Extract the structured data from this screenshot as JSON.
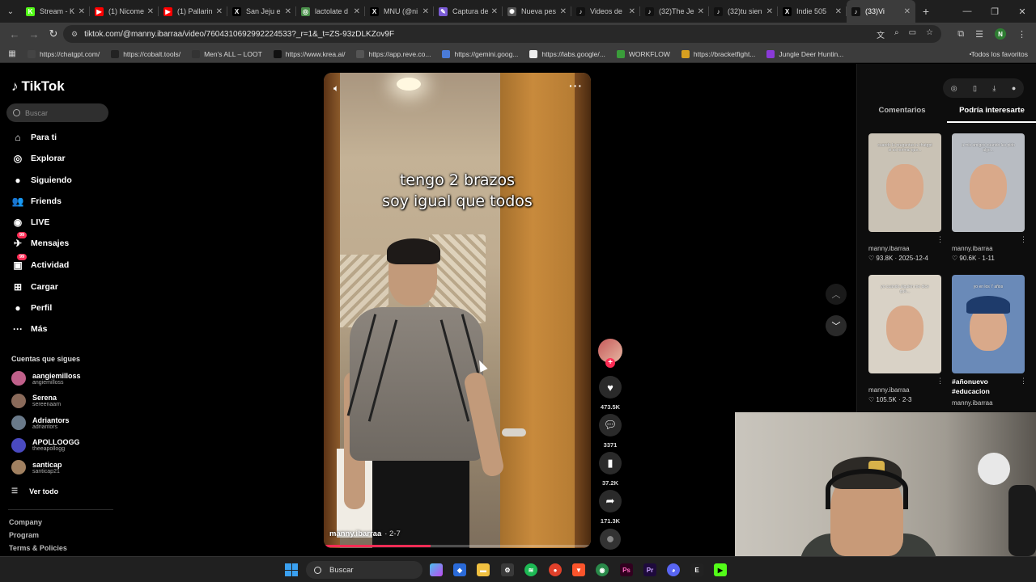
{
  "browser": {
    "tabs": [
      {
        "title": "Stream - K",
        "icon": "kick-icon",
        "color": "#53fc18",
        "glyph": "K"
      },
      {
        "title": "(1) Nicome",
        "icon": "youtube-icon",
        "color": "#ff0000",
        "glyph": "▶"
      },
      {
        "title": "(1) Pallarin",
        "icon": "youtube-icon",
        "color": "#ff0000",
        "glyph": "▶"
      },
      {
        "title": "San Jeju e",
        "icon": "x-icon",
        "color": "#000000",
        "glyph": "X"
      },
      {
        "title": "lactolate d",
        "icon": "globe-icon",
        "color": "#4a8f4a",
        "glyph": "◎"
      },
      {
        "title": "MNU (@ni",
        "icon": "x-icon",
        "color": "#000000",
        "glyph": "X"
      },
      {
        "title": "Captura de",
        "icon": "pen-icon",
        "color": "#7b5cd6",
        "glyph": "✎"
      },
      {
        "title": "Nueva pes",
        "icon": "openai-icon",
        "color": "#555555",
        "glyph": "✺"
      },
      {
        "title": "Videos de",
        "icon": "tiktok-icon",
        "color": "#111111",
        "glyph": "♪"
      },
      {
        "title": "(32)The Je",
        "icon": "tiktok-icon",
        "color": "#111111",
        "glyph": "♪"
      },
      {
        "title": "(32)tu sien",
        "icon": "tiktok-icon",
        "color": "#111111",
        "glyph": "♪"
      },
      {
        "title": "Indie 505",
        "icon": "x-icon",
        "color": "#000000",
        "glyph": "X"
      },
      {
        "title": "(33)Vi",
        "icon": "tiktok-icon",
        "color": "#111111",
        "glyph": "♪",
        "active": true
      }
    ],
    "url": "tiktok.com/@manny.ibarraa/video/7604310692992224533?_r=1&_t=ZS-93zDLKZov9F",
    "profile_initial": "N",
    "bookmarks": [
      {
        "label": "https://chatgpt.com/",
        "color": "#444444"
      },
      {
        "label": "https://cobalt.tools/",
        "color": "#222222"
      },
      {
        "label": "Men's ALL – LOOT",
        "color": "#333333"
      },
      {
        "label": "https://www.krea.ai/",
        "color": "#111111"
      },
      {
        "label": "https://app.reve.co...",
        "color": "#555555"
      },
      {
        "label": "https://gemini.goog...",
        "color": "#4a7bd8"
      },
      {
        "label": "https://labs.google/...",
        "color": "#eeeeee"
      },
      {
        "label": "WORKFLOW",
        "color": "#3a9d3a"
      },
      {
        "label": "https://bracketfight...",
        "color": "#d8a020"
      },
      {
        "label": "Jungle Deer Huntin...",
        "color": "#8a3ad8"
      }
    ],
    "all_bookmarks": "Todos los favoritos"
  },
  "sidebar": {
    "brand": "TikTok",
    "search_placeholder": "Buscar",
    "nav": [
      {
        "label": "Para ti",
        "icon": "home-icon",
        "glyph": "⌂"
      },
      {
        "label": "Explorar",
        "icon": "compass-icon",
        "glyph": "◎"
      },
      {
        "label": "Siguiendo",
        "icon": "following-avatar-icon",
        "glyph": "●"
      },
      {
        "label": "Friends",
        "icon": "friends-icon",
        "glyph": "👥"
      },
      {
        "label": "LIVE",
        "icon": "live-icon",
        "glyph": "◉"
      },
      {
        "label": "Mensajes",
        "icon": "messages-icon",
        "glyph": "✈",
        "badge": "99"
      },
      {
        "label": "Actividad",
        "icon": "activity-icon",
        "glyph": "▣",
        "badge": "99"
      },
      {
        "label": "Cargar",
        "icon": "upload-icon",
        "glyph": "⊞"
      },
      {
        "label": "Perfil",
        "icon": "profile-icon",
        "glyph": "●"
      },
      {
        "label": "Más",
        "icon": "more-icon",
        "glyph": "···"
      }
    ],
    "following_header": "Cuentas que sigues",
    "following": [
      {
        "name": "aangiemilloss",
        "handle": "angiemilloss",
        "color": "#c0608a"
      },
      {
        "name": "Serena",
        "handle": "sereenaam",
        "color": "#8a6a5a"
      },
      {
        "name": "Adriantors",
        "handle": "adriantors",
        "color": "#6a7a8a"
      },
      {
        "name": "APOLLOOGG",
        "handle": "theeapollogg",
        "color": "#4a4ac0"
      },
      {
        "name": "santicap",
        "handle": "santicap21",
        "color": "#a08060"
      }
    ],
    "see_all": "Ver todo",
    "footer": [
      "Company",
      "Program",
      "Terms & Policies"
    ]
  },
  "video": {
    "caption_line1": "tengo 2 brazos",
    "caption_line2": "soy igual que todos",
    "author": "manny.ibarraa",
    "date": "· 2-7",
    "progress": 0.4,
    "likes": "473.5K",
    "comments": "3371",
    "saves": "37.2K",
    "shares": "171.3K"
  },
  "right_panel": {
    "tabs": [
      "Comentarios",
      "Podría interesarte"
    ],
    "suggestions": [
      {
        "author": "manny.ibarraa",
        "stats": "♡ 93.8K · 2025-12-4",
        "overlay": "cuando le preguntas a chatgpt si es normal que...",
        "bg": "#c9c2b5"
      },
      {
        "author": "manny.ibarraa",
        "stats": "♡ 90.6K · 1-11",
        "overlay": "a mis amigos cuando les pido algo...",
        "bg": "#b8bcc2"
      },
      {
        "author": "manny.ibarraa",
        "stats": "♡ 105.5K · 2-3",
        "overlay": "yo cuando alguien me dice que...",
        "bg": "#d9d2c6"
      },
      {
        "author": "manny.ibarraa",
        "stats": "#añonuevo #educacion",
        "overlay": "yo en los 7 años",
        "bg": "#6a8ab8"
      }
    ]
  },
  "taskbar": {
    "search_label": "Buscar"
  }
}
